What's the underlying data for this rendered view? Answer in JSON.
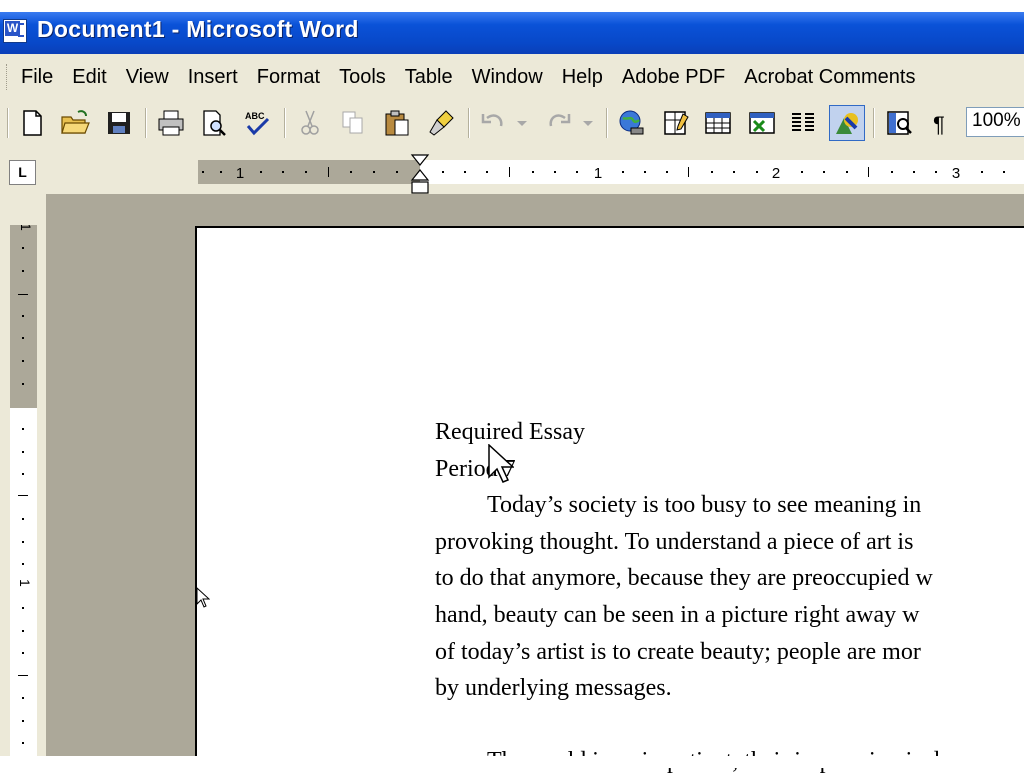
{
  "window": {
    "title": "Document1 - Microsoft Word",
    "app_icon_letter": "W"
  },
  "menu": [
    "File",
    "Edit",
    "View",
    "Insert",
    "Format",
    "Tools",
    "Table",
    "Window",
    "Help",
    "Adobe PDF",
    "Acrobat Comments"
  ],
  "toolbar": {
    "zoom": "100%"
  },
  "ruler": {
    "tab_selector": "L",
    "h_numbers": [
      "1",
      "1",
      "2",
      "3"
    ],
    "v_numbers": [
      "1",
      "1"
    ]
  },
  "document": {
    "line1": "Required Essay",
    "line2": "Period 7",
    "paragraph1": [
      "Today’s society is too busy to see meaning in",
      "provoking thought.  To understand a piece of art is",
      "to do that anymore, because they are preoccupied w",
      "hand, beauty can be seen in a picture right away w",
      "of today’s artist is to create beauty; people are mor",
      "by underlying messages."
    ],
    "paragraph2_partial": "The world is so impatient, their impression is du"
  }
}
